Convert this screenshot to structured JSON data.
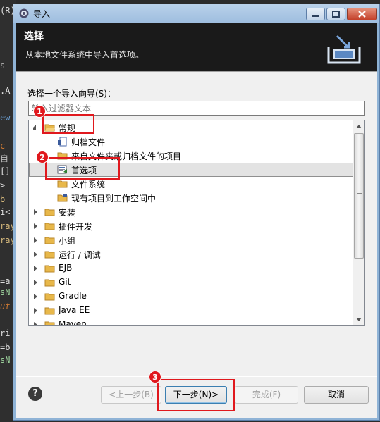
{
  "window": {
    "title": "导入"
  },
  "header": {
    "title": "选择",
    "description": "从本地文件系统中导入首选项。"
  },
  "wizard": {
    "label": "选择一个导入向导(S)：",
    "filter_placeholder": "输入过滤器文本"
  },
  "tree": {
    "items": [
      {
        "label": "常规",
        "state": "expanded",
        "icon": "folder-open-icon"
      },
      {
        "label": "归档文件",
        "icon": "archive-file-icon"
      },
      {
        "label": "来自文件夹或归档文件的项目",
        "icon": "folder-project-icon"
      },
      {
        "label": "首选项",
        "icon": "preferences-icon",
        "selected": true
      },
      {
        "label": "文件系统",
        "icon": "folder-icon"
      },
      {
        "label": "现有项目到工作空间中",
        "icon": "project-import-icon"
      },
      {
        "label": "安装",
        "state": "collapsed",
        "icon": "folder-icon"
      },
      {
        "label": "插件开发",
        "state": "collapsed",
        "icon": "folder-icon"
      },
      {
        "label": "小组",
        "state": "collapsed",
        "icon": "folder-icon"
      },
      {
        "label": "运行 / 调试",
        "state": "collapsed",
        "icon": "folder-icon"
      },
      {
        "label": "EJB",
        "state": "collapsed",
        "icon": "folder-icon"
      },
      {
        "label": "Git",
        "state": "collapsed",
        "icon": "folder-icon"
      },
      {
        "label": "Gradle",
        "state": "collapsed",
        "icon": "folder-icon"
      },
      {
        "label": "Java EE",
        "state": "collapsed",
        "icon": "folder-icon"
      },
      {
        "label": "Maven",
        "state": "collapsed",
        "icon": "folder-icon"
      }
    ]
  },
  "buttons": {
    "back": "<上一步(B)",
    "next": "下一步(N)>",
    "finish": "完成(F)",
    "cancel": "取消",
    "help": "?"
  },
  "annotations": [
    "1",
    "2",
    "3"
  ],
  "editor_strip": {
    "lines": [
      "(R)",
      "",
      "s",
      "",
      ".A",
      "",
      "ew",
      "",
      "c",
      "自",
      "[]",
      ">",
      "b",
      "i<",
      "ray",
      "ray",
      "",
      "=a",
      "sN",
      "ut",
      "",
      "ri",
      "=b",
      "sN"
    ]
  },
  "colors": {
    "accent": "#3c7fb1",
    "annotation": "#e0181d",
    "header_bg": "#1a1a1a",
    "folder": "#e8b84a"
  }
}
